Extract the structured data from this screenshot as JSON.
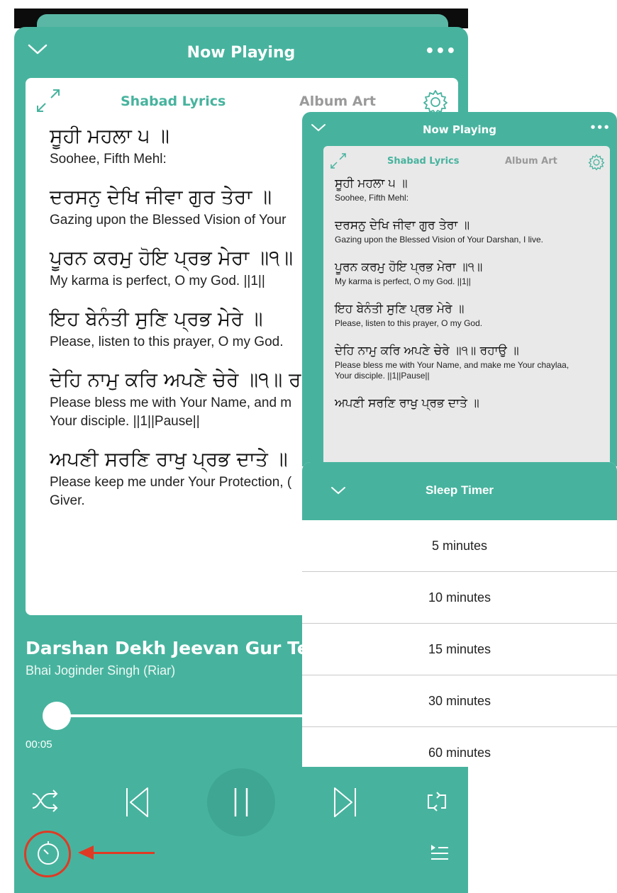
{
  "player": {
    "title": "Now Playing",
    "more_label": "•••",
    "tabs": {
      "lyrics": "Shabad Lyrics",
      "album": "Album Art"
    },
    "lyrics": [
      {
        "gurmukhi": "ਸੂਹੀ ਮਹਲਾ ੫ ॥",
        "translation": "Soohee, Fifth Mehl:"
      },
      {
        "gurmukhi": "ਦਰਸਨੁ ਦੇਖਿ ਜੀਵਾ ਗੁਰ ਤੇਰਾ ॥",
        "translation": "Gazing upon the Blessed Vision of Your"
      },
      {
        "gurmukhi": "ਪੂਰਨ ਕਰਮੁ ਹੋਇ ਪ੍ਰਭ ਮੇਰਾ ॥੧॥",
        "translation": "My karma is perfect, O my God. ||1||"
      },
      {
        "gurmukhi": "ਇਹ ਬੇਨੰਤੀ ਸੁਣਿ ਪ੍ਰਭ ਮੇਰੇ ॥",
        "translation": "Please, listen to this prayer, O my God."
      },
      {
        "gurmukhi": "ਦੇਹਿ ਨਾਮੁ ਕਰਿ ਅਪਣੇ ਚੇਰੇ ॥੧॥ ਰ",
        "translation": "Please bless me with Your Name, and m\nYour disciple. ||1||Pause||"
      },
      {
        "gurmukhi": "ਅਪਣੀ ਸਰਣਿ ਰਾਖੁ ਪ੍ਰਭ ਦਾਤੇ ॥",
        "translation": "Please keep me under Your Protection, (\nGiver."
      }
    ],
    "track_title": "Darshan Dekh Jeevan Gur Tera",
    "artist": "Bhai Joginder Singh (Riar)",
    "elapsed": "00:05",
    "progress": 0.04
  },
  "inset": {
    "title": "Now Playing",
    "more_label": "•••",
    "tabs": {
      "lyrics": "Shabad Lyrics",
      "album": "Album Art"
    },
    "lyrics": [
      {
        "gurmukhi": "ਸੂਹੀ ਮਹਲਾ ੫ ॥",
        "translation": "Soohee, Fifth Mehl:"
      },
      {
        "gurmukhi": "ਦਰਸਨੁ ਦੇਖਿ ਜੀਵਾ ਗੁਰ ਤੇਰਾ ॥",
        "translation": "Gazing upon the Blessed Vision of Your Darshan, I live."
      },
      {
        "gurmukhi": "ਪੂਰਨ ਕਰਮੁ ਹੋਇ ਪ੍ਰਭ ਮੇਰਾ ॥੧॥",
        "translation": "My karma is perfect, O my God. ||1||"
      },
      {
        "gurmukhi": "ਇਹ ਬੇਨੰਤੀ ਸੁਣਿ ਪ੍ਰਭ ਮੇਰੇ ॥",
        "translation": "Please, listen to this prayer, O my God."
      },
      {
        "gurmukhi": "ਦੇਹਿ ਨਾਮੁ ਕਰਿ ਅਪਣੇ ਚੇਰੇ ॥੧॥ ਰਹਾਉ ॥",
        "translation": "Please bless me with Your Name, and make me Your chaylaa,\nYour disciple. ||1||Pause||"
      },
      {
        "gurmukhi": "ਅਪਣੀ ਸਰਣਿ ਰਾਖੁ ਪ੍ਰਭ ਦਾਤੇ ॥",
        "translation": ""
      }
    ]
  },
  "sleep_timer": {
    "title": "Sleep Timer",
    "options": [
      "5 minutes",
      "10 minutes",
      "15 minutes",
      "30 minutes",
      "60 minutes"
    ]
  },
  "colors": {
    "accent": "#47b39e",
    "highlight": "#e03a24"
  },
  "icons": [
    "chevron-down-icon",
    "more-icon",
    "expand-icon",
    "gear-icon",
    "shuffle-icon",
    "previous-icon",
    "pause-icon",
    "next-icon",
    "repeat-icon",
    "sleep-timer-icon",
    "queue-icon",
    "arrow-icon"
  ]
}
